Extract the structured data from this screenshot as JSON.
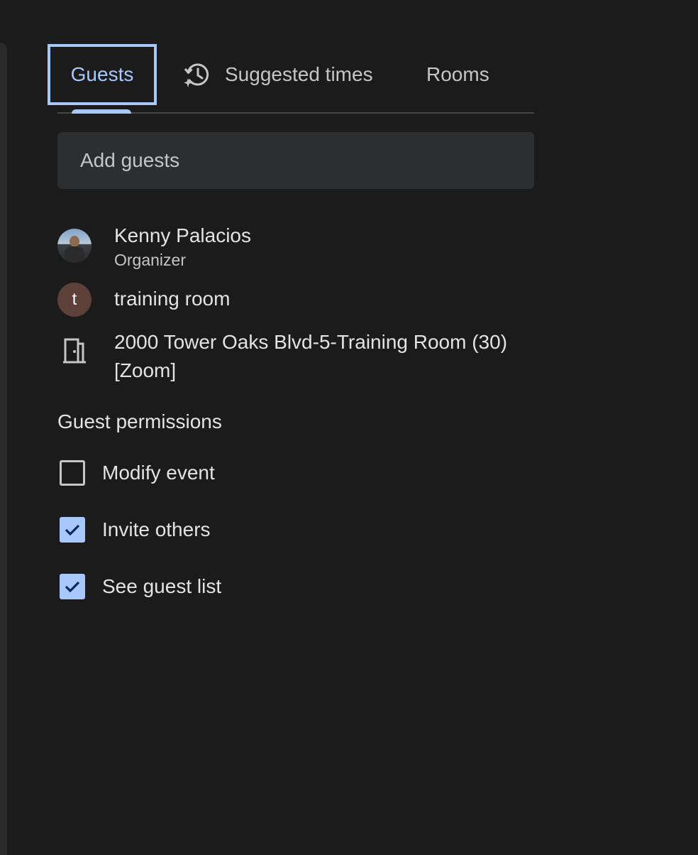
{
  "tabs": {
    "guests": "Guests",
    "suggested_times": "Suggested times",
    "rooms": "Rooms"
  },
  "add_guests": {
    "placeholder": "Add guests"
  },
  "guests": [
    {
      "name": "Kenny Palacios",
      "role": "Organizer",
      "avatar": "photo"
    },
    {
      "name": "training room",
      "avatar_letter": "t",
      "avatar_color": "#5d4037"
    }
  ],
  "room": {
    "name": "2000 Tower Oaks Blvd-5-Training Room (30) [Zoom]",
    "icon": "door-icon"
  },
  "permissions": {
    "title": "Guest permissions",
    "items": [
      {
        "label": "Modify event",
        "checked": false
      },
      {
        "label": "Invite others",
        "checked": true
      },
      {
        "label": "See guest list",
        "checked": true
      }
    ]
  },
  "colors": {
    "accent": "#a8c7fa",
    "background": "#1b1b1b",
    "input_bg": "#2d2e30"
  }
}
